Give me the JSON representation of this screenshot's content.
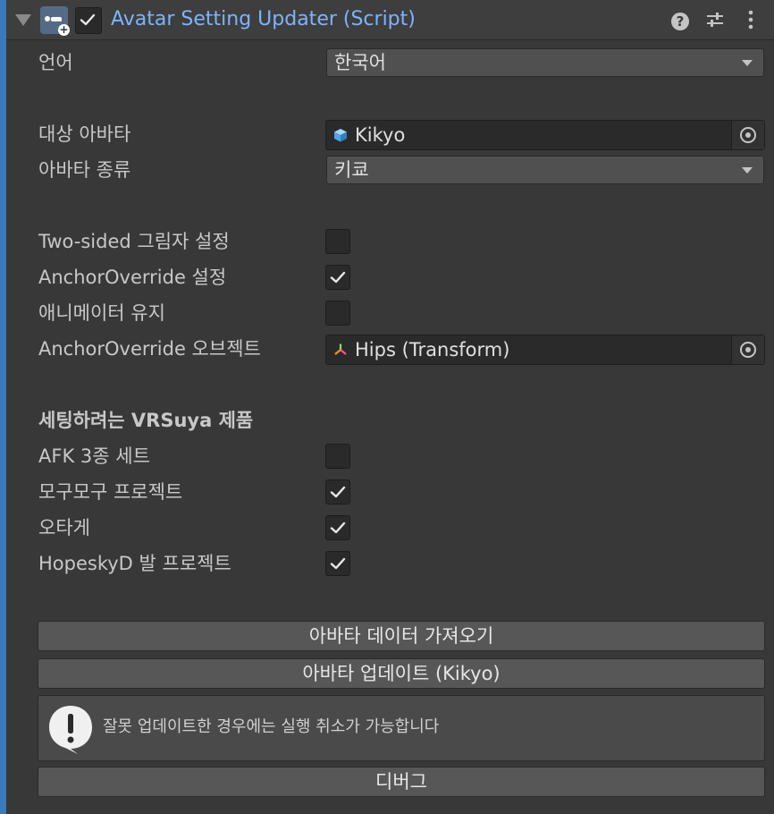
{
  "header": {
    "title": "Avatar Setting Updater (Script)",
    "enabled": true,
    "icons": [
      "foldout-arrow-icon",
      "script-icon",
      "help-icon",
      "preset-icon",
      "menu-icon"
    ]
  },
  "fields": {
    "language": {
      "label": "언어",
      "value": "한국어"
    },
    "target_avatar": {
      "label": "대상 아바타",
      "value": "Kikyo",
      "icon": "prefab-cube-icon"
    },
    "avatar_type": {
      "label": "아바타 종류",
      "value": "키쿄"
    },
    "two_sided_shadow": {
      "label": "Two-sided 그림자 설정",
      "checked": false
    },
    "anchor_override": {
      "label": "AnchorOverride 설정",
      "checked": true
    },
    "keep_animator": {
      "label": "애니메이터 유지",
      "checked": false
    },
    "anchor_object": {
      "label": "AnchorOverride 오브젝트",
      "value": "Hips (Transform)",
      "icon": "transform-icon"
    }
  },
  "products": {
    "section_title": "세팅하려는 VRSuya 제품",
    "items": [
      {
        "label": "AFK 3종 세트",
        "checked": false
      },
      {
        "label": "모구모구 프로젝트",
        "checked": true
      },
      {
        "label": "오타게",
        "checked": true
      },
      {
        "label": "HopeskyD 발 프로젝트",
        "checked": true
      }
    ]
  },
  "buttons": {
    "import": "아바타 데이터 가져오기",
    "update": "아바타 업데이트 (Kikyo)",
    "debug": "디버그"
  },
  "help_box": {
    "message": "잘못 업데이트한 경우에는 실행 취소가 가능합니다",
    "icon": "warning-icon"
  },
  "colors": {
    "title": "#7cb4ff",
    "accent": "#3a79bb",
    "background": "#383838"
  }
}
